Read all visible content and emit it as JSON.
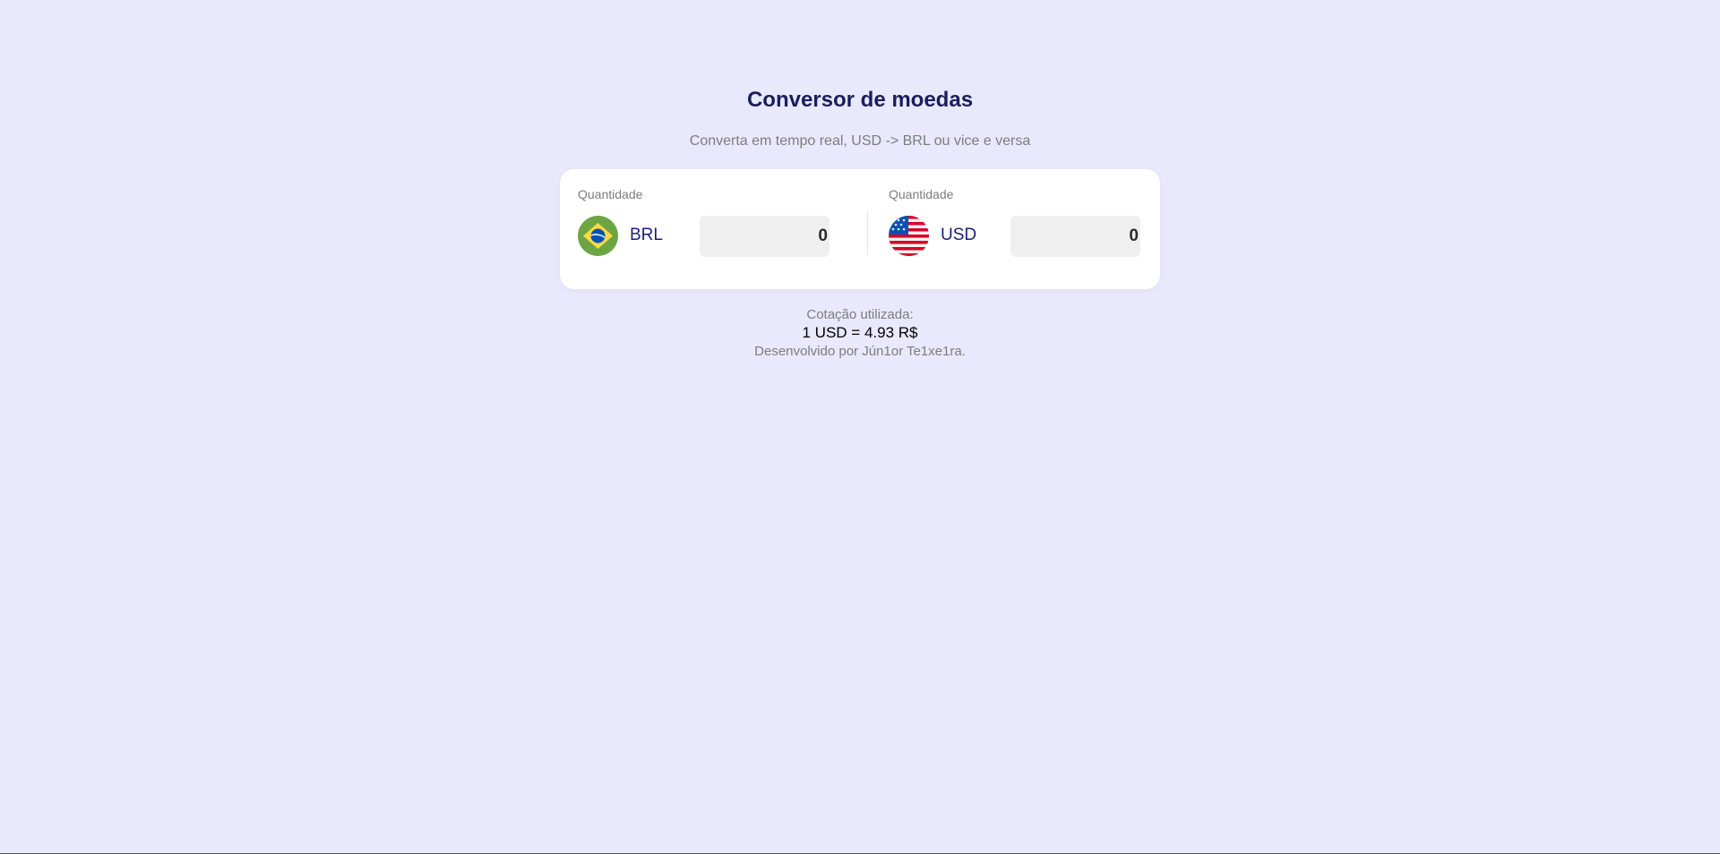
{
  "header": {
    "title": "Conversor de moedas",
    "subtitle": "Converta em tempo real, USD -> BRL ou vice e versa"
  },
  "converter": {
    "from": {
      "label": "Quantidade",
      "currency": "BRL",
      "flag_icon": "brazil-flag-icon",
      "value": "0"
    },
    "to": {
      "label": "Quantidade",
      "currency": "USD",
      "flag_icon": "usa-flag-icon",
      "value": "0"
    }
  },
  "rate": {
    "label": "Cotação utilizada:",
    "value": "1 USD = 4.93 R$"
  },
  "footer": {
    "credits": "Desenvolvido por Jún1or Te1xe1ra."
  },
  "colors": {
    "background": "#e8e9fc",
    "title": "#1c1d5c",
    "currency_code": "#1c1d7a",
    "muted_text": "#7d7d7d",
    "input_bg": "#efefef"
  }
}
